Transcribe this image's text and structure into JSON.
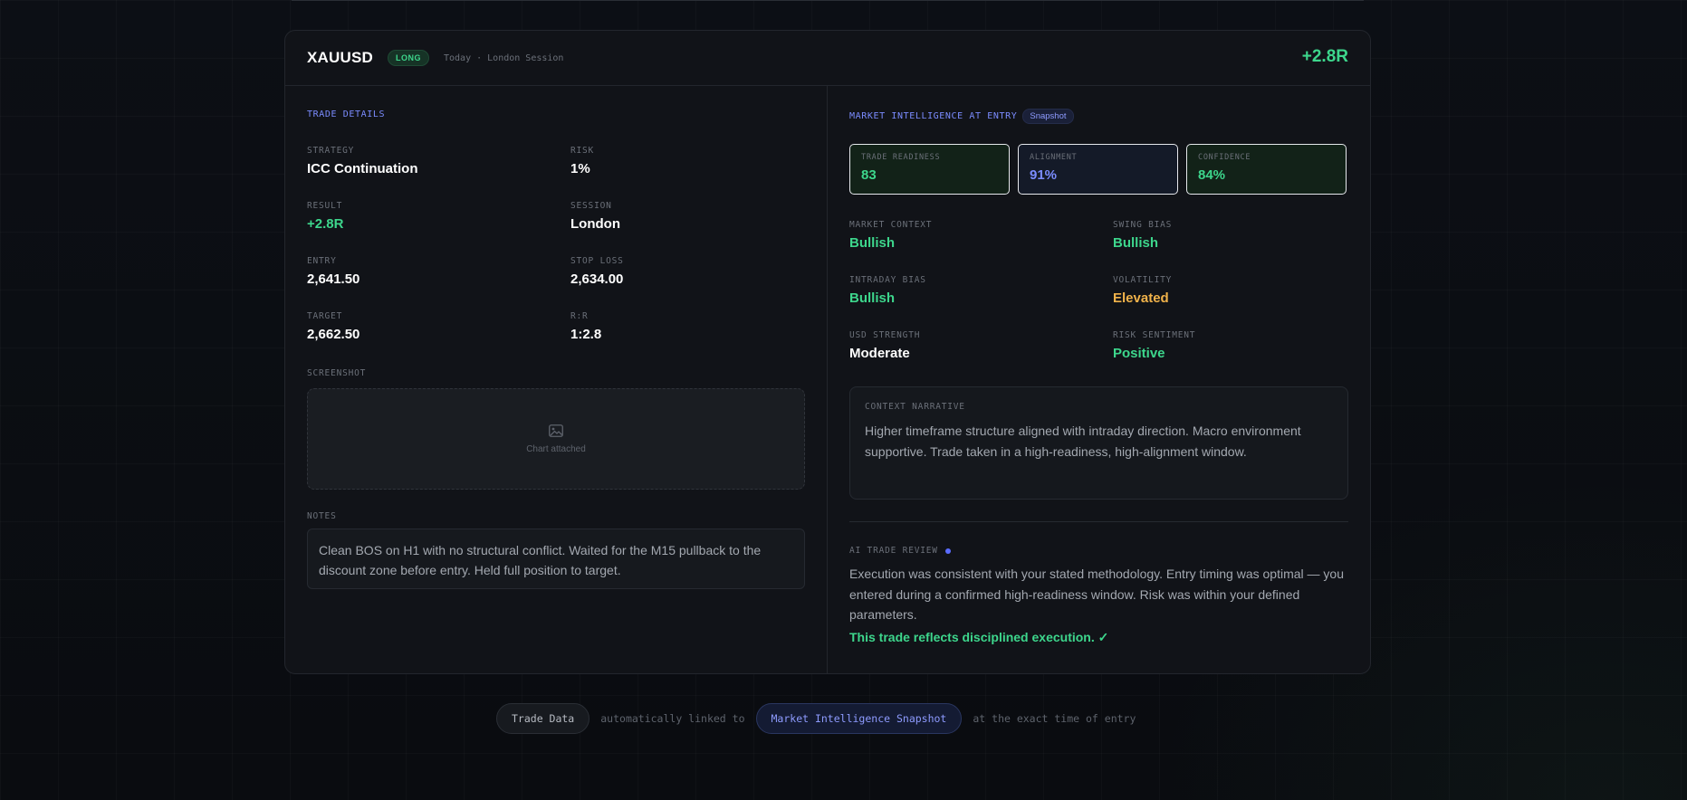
{
  "header": {
    "symbol": "XAUUSD",
    "direction": "LONG",
    "session_info": "Today · London Session",
    "result": "+2.8R"
  },
  "trade_details": {
    "title": "TRADE DETAILS",
    "fields": {
      "strategy": {
        "label": "STRATEGY",
        "value": "ICC Continuation"
      },
      "risk": {
        "label": "RISK",
        "value": "1%"
      },
      "result": {
        "label": "RESULT",
        "value": "+2.8R"
      },
      "session": {
        "label": "SESSION",
        "value": "London"
      },
      "entry": {
        "label": "ENTRY",
        "value": "2,641.50"
      },
      "stop_loss": {
        "label": "STOP LOSS",
        "value": "2,634.00"
      },
      "target": {
        "label": "TARGET",
        "value": "2,662.50"
      },
      "rr": {
        "label": "R:R",
        "value": "1:2.8"
      }
    },
    "screenshot_label": "SCREENSHOT",
    "screenshot_text": "Chart attached",
    "notes_label": "NOTES",
    "notes_text": "Clean BOS on H1 with no structural conflict. Waited for the M15 pullback to the discount zone before entry. Held full position to target."
  },
  "market_intel": {
    "title": "MARKET INTELLIGENCE AT ENTRY",
    "badge": "Snapshot",
    "metrics": [
      {
        "label": "TRADE READINESS",
        "value": "83"
      },
      {
        "label": "ALIGNMENT",
        "value": "91%"
      },
      {
        "label": "CONFIDENCE",
        "value": "84%"
      }
    ],
    "fields": {
      "market_context": {
        "label": "MARKET CONTEXT",
        "value": "Bullish"
      },
      "swing_bias": {
        "label": "SWING BIAS",
        "value": "Bullish"
      },
      "intraday_bias": {
        "label": "INTRADAY BIAS",
        "value": "Bullish"
      },
      "volatility": {
        "label": "VOLATILITY",
        "value": "Elevated"
      },
      "usd_strength": {
        "label": "USD STRENGTH",
        "value": "Moderate"
      },
      "risk_sentiment": {
        "label": "RISK SENTIMENT",
        "value": "Positive"
      }
    },
    "narrative_label": "CONTEXT NARRATIVE",
    "narrative_text": "Higher timeframe structure aligned with intraday direction. Macro environment supportive. Trade taken in a high-readiness, high-alignment window.",
    "ai_label": "AI TRADE REVIEW",
    "ai_text": "Execution was consistent with your stated methodology. Entry timing was optimal — you entered during a confirmed high-readiness window. Risk was within your defined parameters.",
    "ai_verdict": "This trade reflects disciplined execution. ✓"
  },
  "footer": {
    "pill_left": "Trade Data",
    "middle_text": "automatically linked to",
    "pill_right": "Market Intelligence Snapshot",
    "end_text": "at the exact time of entry"
  },
  "colors": {
    "accent_green": "#3dd68c",
    "accent_blue": "#7b8cff",
    "accent_amber": "#f0b24a",
    "background": "#0b0d12",
    "card": "#111318"
  }
}
